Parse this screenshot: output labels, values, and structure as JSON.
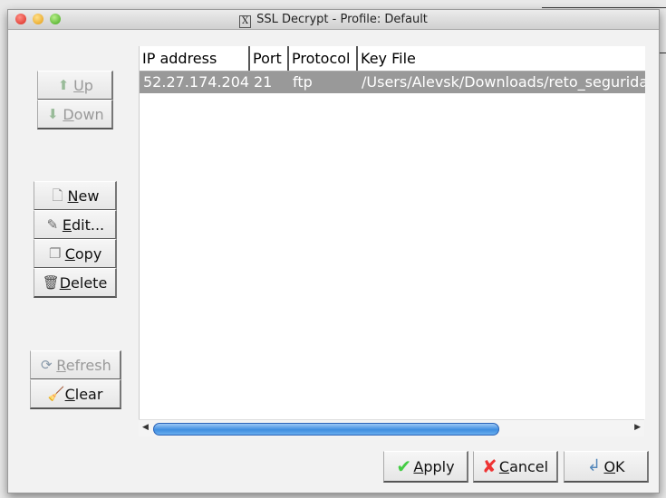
{
  "window": {
    "title": "SSL Decrypt - Profile: Default",
    "title_icon": "x11-icon"
  },
  "side_buttons": {
    "up": {
      "label": "Up",
      "icon": "arrow-up-icon",
      "enabled": false
    },
    "down": {
      "label": "Down",
      "icon": "arrow-down-icon",
      "enabled": false
    },
    "new": {
      "label": "New",
      "icon": "document-icon",
      "enabled": true
    },
    "edit": {
      "label": "Edit...",
      "icon": "edit-icon",
      "enabled": true
    },
    "copy": {
      "label": "Copy",
      "icon": "copy-icon",
      "enabled": true
    },
    "delete": {
      "label": "Delete",
      "icon": "trash-icon",
      "enabled": true
    },
    "refresh": {
      "label": "Refresh",
      "icon": "refresh-icon",
      "enabled": false
    },
    "clear": {
      "label": "Clear",
      "icon": "broom-icon",
      "enabled": true
    }
  },
  "table": {
    "columns": [
      "IP address",
      "Port",
      "Protocol",
      "Key File"
    ],
    "rows": [
      [
        "52.27.174.204",
        "21",
        "ftp",
        "/Users/Alevsk/Downloads/reto_seguridad"
      ]
    ],
    "selected_row": 0
  },
  "footer": {
    "apply": "Apply",
    "cancel": "Cancel",
    "ok": "OK"
  },
  "colors": {
    "selection": "#999999",
    "scroll_thumb": "#3f8ee0"
  }
}
